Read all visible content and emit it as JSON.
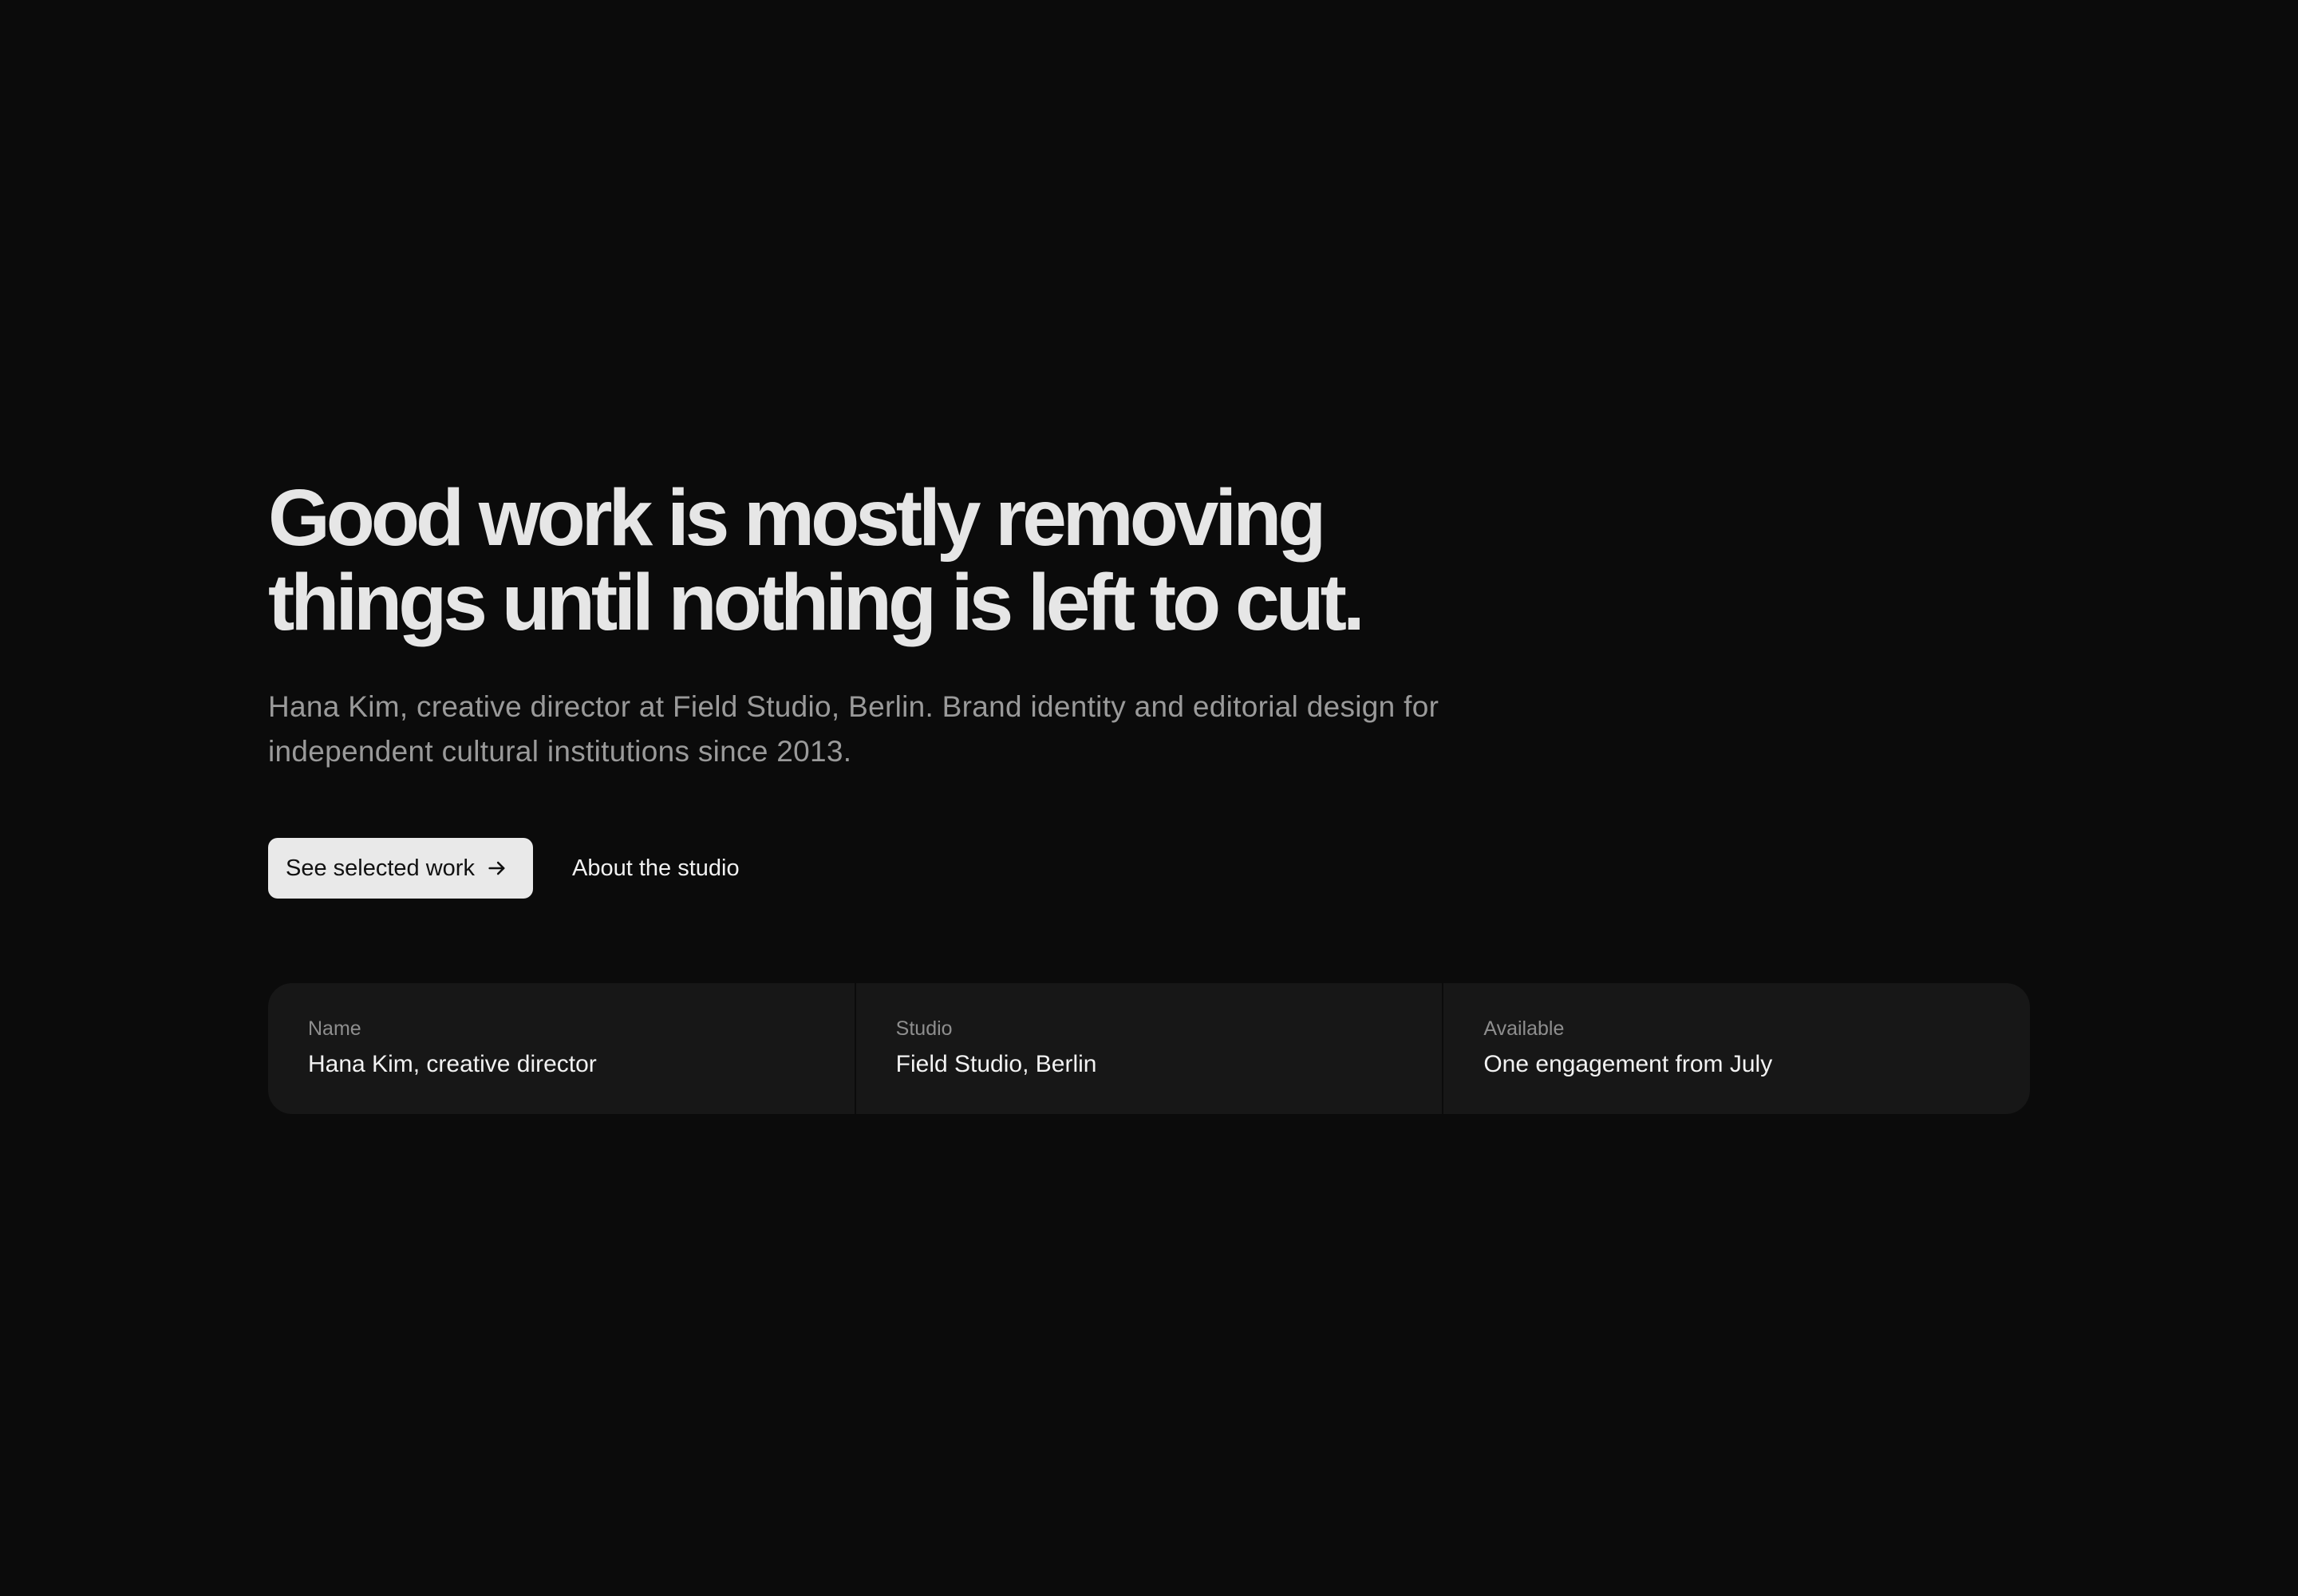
{
  "hero": {
    "headline_line1": "Good work is mostly removing",
    "headline_line2": "things until nothing is left to cut.",
    "lede": "Hana Kim, creative director at Field Studio, Berlin. Brand identity and editorial design for independent cultural institutions since 2013."
  },
  "actions": {
    "primary_label": "See selected work",
    "primary_icon": "arrow-right-icon",
    "secondary_label": "About the studio"
  },
  "info": [
    {
      "label": "Name",
      "value": "Hana Kim, creative director"
    },
    {
      "label": "Studio",
      "value": "Field Studio, Berlin"
    },
    {
      "label": "Available",
      "value": "One engagement from July"
    }
  ],
  "colors": {
    "background": "#0b0b0b",
    "card": "#171717",
    "headline": "#e6e6e6",
    "muted": "#9a9a9a",
    "button_bg": "#e9e9e9"
  }
}
